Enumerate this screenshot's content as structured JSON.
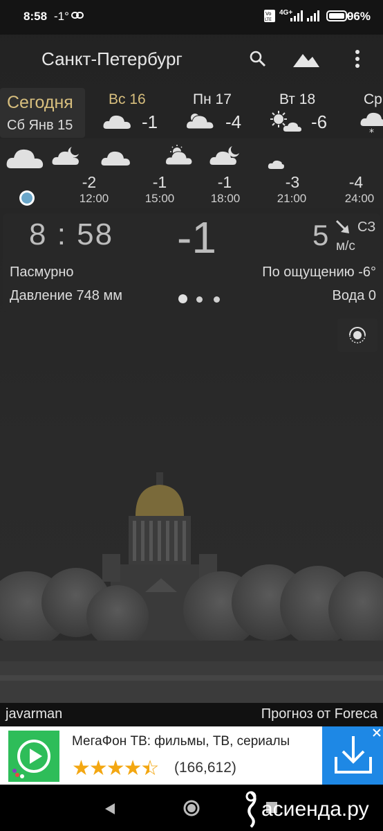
{
  "status_bar": {
    "time": "8:58",
    "temp": "-1°",
    "battery": "96%",
    "network": "4G+"
  },
  "header": {
    "city": "Санкт-Петербург"
  },
  "days": {
    "today_label": "Сегодня",
    "today_date": "Сб Янв 15",
    "items": [
      {
        "name": "Вс 16",
        "temp": "-1",
        "icon": "cloud-icon"
      },
      {
        "name": "Пн 17",
        "temp": "-4",
        "icon": "cloud-icon"
      },
      {
        "name": "Вт 18",
        "temp": "-6",
        "icon": "sun-cloud-icon"
      },
      {
        "name": "Ср",
        "temp": "",
        "icon": "snow-cloud-icon"
      }
    ]
  },
  "hours": [
    {
      "temp": "-2",
      "time": "12:00"
    },
    {
      "temp": "-1",
      "time": "15:00"
    },
    {
      "temp": "-1",
      "time": "18:00"
    },
    {
      "temp": "-3",
      "time": "21:00"
    },
    {
      "temp": "-4",
      "time": "24:00"
    }
  ],
  "current": {
    "time": "8:58",
    "temp": "-1",
    "wind_speed": "5",
    "wind_dir": "СЗ",
    "wind_unit": "м/с",
    "description": "Пасмурно",
    "feels_like": "По ощущению -6°",
    "pressure": "Давление 748 мм",
    "water": "Вода 0"
  },
  "footer": {
    "author": "javarman",
    "credit": "Прогноз от Foreca"
  },
  "ad": {
    "title": "МегаФон ТВ: фильмы, ТВ, сериалы",
    "rating_count": "(166,612)",
    "stars": 4.5
  },
  "watermark": "асиенда.ру",
  "colors": {
    "today_accent": "#d8bf7e",
    "ad_button": "#1e88e5",
    "ad_icon": "#2ebd59"
  }
}
